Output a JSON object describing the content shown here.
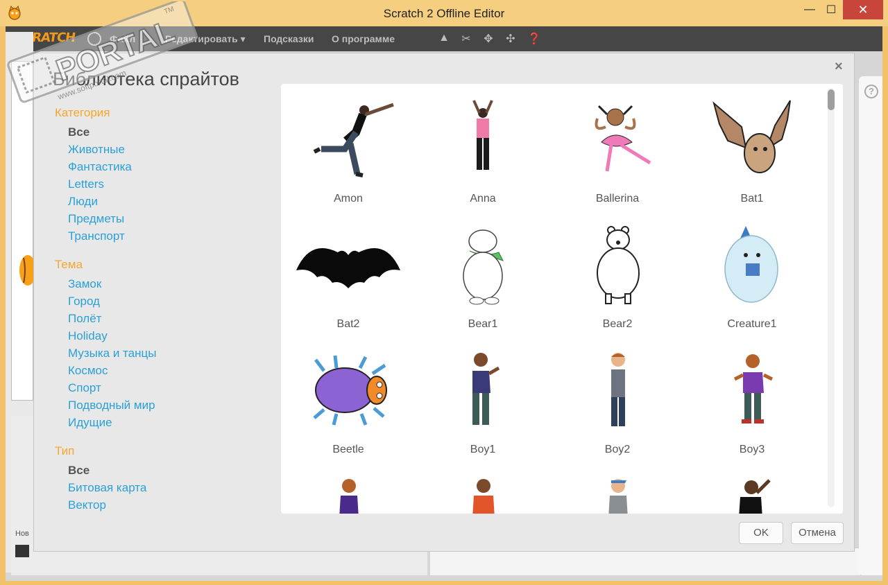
{
  "window": {
    "title": "Scratch 2 Offline Editor",
    "minimize_glyph": "—",
    "maximize_glyph": "☐",
    "close_glyph": "✕"
  },
  "menubar": {
    "logo": "SCRATCH",
    "file_label": "Файл",
    "edit_label": "Редактировать ▾",
    "tips_label": "Подсказки",
    "about_label": "О программе",
    "tools": [
      "stamp-icon",
      "cut-icon",
      "grow-icon",
      "shrink-icon",
      "help-icon"
    ]
  },
  "background": {
    "new_sprite_label": "Нов",
    "help_glyph": "?"
  },
  "dialog": {
    "title": "Библиотека спрайтов",
    "close_glyph": "×",
    "ok_label": "OK",
    "cancel_label": "Отмена"
  },
  "sidebar": {
    "category_heading": "Категория",
    "categories": [
      "Все",
      "Животные",
      "Фантастика",
      "Letters",
      "Люди",
      "Предметы",
      "Транспорт"
    ],
    "theme_heading": "Тема",
    "themes": [
      "Замок",
      "Город",
      "Полёт",
      "Holiday",
      "Музыка и танцы",
      "Космос",
      "Спорт",
      "Подводный мир",
      "Идущие"
    ],
    "type_heading": "Тип",
    "types": [
      "Все",
      "Битовая карта",
      "Вектор"
    ]
  },
  "sprites": [
    {
      "name": "Amon",
      "icon": "dancer-man-icon"
    },
    {
      "name": "Anna",
      "icon": "dancer-girl-icon"
    },
    {
      "name": "Ballerina",
      "icon": "ballerina-icon"
    },
    {
      "name": "Bat1",
      "icon": "brown-bat-icon"
    },
    {
      "name": "Bat2",
      "icon": "black-bat-icon"
    },
    {
      "name": "Bear1",
      "icon": "polar-bear-scarf-icon"
    },
    {
      "name": "Bear2",
      "icon": "bear-outline-icon"
    },
    {
      "name": "Creature1",
      "icon": "creature-icon"
    },
    {
      "name": "Beetle",
      "icon": "beetle-icon"
    },
    {
      "name": "Boy1",
      "icon": "boy-icon"
    },
    {
      "name": "Boy2",
      "icon": "boy-icon"
    },
    {
      "name": "Boy3",
      "icon": "boy-icon"
    },
    {
      "name": "",
      "icon": "boy-partial-icon"
    },
    {
      "name": "",
      "icon": "boy-partial-icon"
    },
    {
      "name": "",
      "icon": "boy-partial-icon"
    },
    {
      "name": "",
      "icon": "boy-partial-icon"
    }
  ],
  "watermark": {
    "brand": "PORTAL",
    "site": "www.softportal.com",
    "trademark": "TM"
  },
  "colors": {
    "accent_orange": "#f7a62c",
    "link_blue": "#2aa0d8",
    "titlebar": "#f5cf7f",
    "close_red": "#c7453a"
  }
}
